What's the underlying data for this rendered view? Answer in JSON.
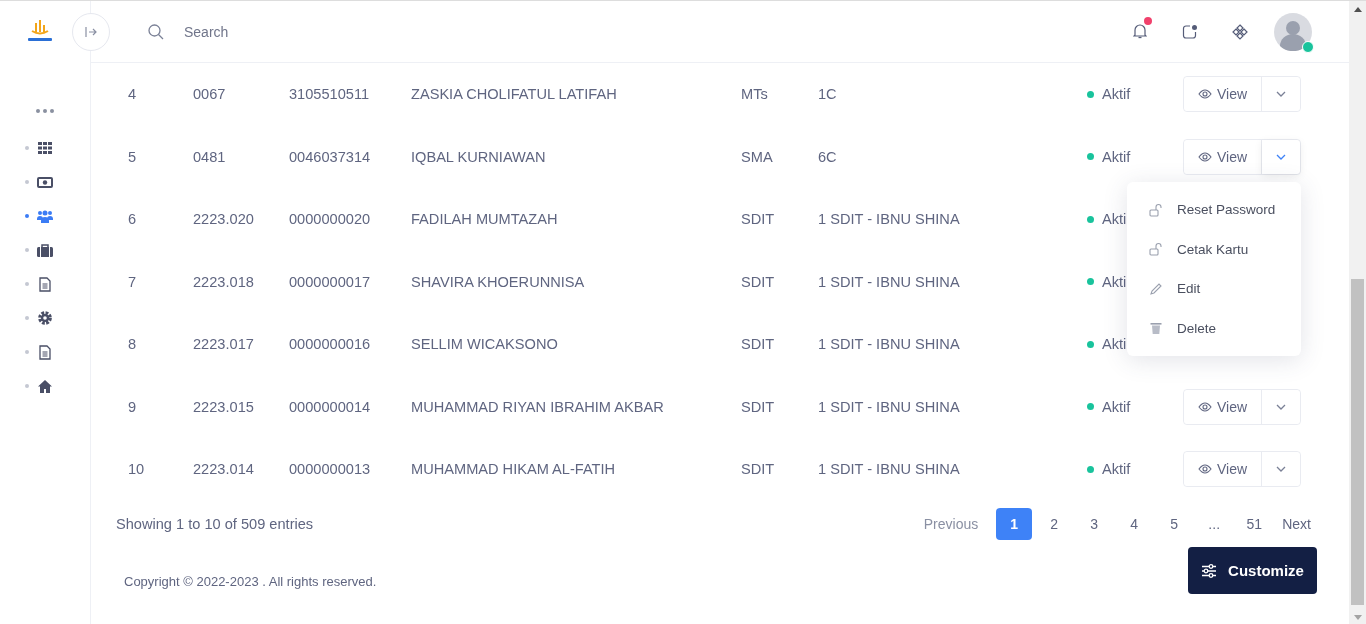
{
  "sidebar": {
    "items": [
      {
        "kind": "more",
        "selected": false
      },
      {
        "kind": "grid",
        "selected": false
      },
      {
        "kind": "money",
        "selected": false
      },
      {
        "kind": "users",
        "selected": true
      },
      {
        "kind": "briefcase",
        "selected": false
      },
      {
        "kind": "document",
        "selected": false
      },
      {
        "kind": "gear",
        "selected": false
      },
      {
        "kind": "document",
        "selected": false
      },
      {
        "kind": "home",
        "selected": false
      }
    ]
  },
  "header": {
    "search": {
      "placeholder": "Search"
    },
    "notifications": {
      "unread": true
    },
    "user": {
      "online": true
    }
  },
  "table": {
    "rows": [
      {
        "no": "4",
        "id": "0067",
        "nisn": "3105510511",
        "name": "ZASKIA CHOLIFATUL LATIFAH",
        "level": "MTs",
        "class": "1C",
        "status": "Aktif",
        "view": "View",
        "expanded": false
      },
      {
        "no": "5",
        "id": "0481",
        "nisn": "0046037314",
        "name": "IQBAL KURNIAWAN",
        "level": "SMA",
        "class": "6C",
        "status": "Aktif",
        "view": "View",
        "expanded": true
      },
      {
        "no": "6",
        "id": "2223.020",
        "nisn": "0000000020",
        "name": "FADILAH MUMTAZAH",
        "level": "SDIT",
        "class": "1 SDIT - IBNU SHINA",
        "status": "Akti"
      },
      {
        "no": "7",
        "id": "2223.018",
        "nisn": "0000000017",
        "name": "SHAVIRA KHOERUNNISA",
        "level": "SDIT",
        "class": "1 SDIT - IBNU SHINA",
        "status": "Akti"
      },
      {
        "no": "8",
        "id": "2223.017",
        "nisn": "0000000016",
        "name": "SELLIM WICAKSONO",
        "level": "SDIT",
        "class": "1 SDIT - IBNU SHINA",
        "status": "Akti"
      },
      {
        "no": "9",
        "id": "2223.015",
        "nisn": "0000000014",
        "name": "MUHAMMAD RIYAN IBRAHIM AKBAR",
        "level": "SDIT",
        "class": "1 SDIT - IBNU SHINA",
        "status": "Aktif",
        "view": "View",
        "expanded": false
      },
      {
        "no": "10",
        "id": "2223.014",
        "nisn": "0000000013",
        "name": "MUHAMMAD HIKAM AL-FATIH",
        "level": "SDIT",
        "class": "1 SDIT - IBNU SHINA",
        "status": "Aktif",
        "view": "View",
        "expanded": false
      }
    ]
  },
  "action_menu": {
    "items": [
      {
        "kind": "lock",
        "label": "Reset Password"
      },
      {
        "kind": "lock",
        "label": "Cetak Kartu"
      },
      {
        "kind": "edit",
        "label": "Edit"
      },
      {
        "kind": "delete",
        "label": "Delete"
      }
    ]
  },
  "pagination": {
    "summary": "Showing 1 to 10 of 509 entries",
    "previous": "Previous",
    "next": "Next",
    "pages": [
      {
        "label": "1",
        "selected": true
      },
      {
        "label": "2",
        "selected": false
      },
      {
        "label": "3",
        "selected": false
      },
      {
        "label": "4",
        "selected": false
      },
      {
        "label": "5",
        "selected": false
      },
      {
        "label": "...",
        "selected": false
      },
      {
        "label": "51",
        "selected": false
      }
    ]
  },
  "footer": {
    "copyright": "Copyright © 2022-2023 . All rights reserved."
  },
  "customize_button": {
    "label": "Customize"
  }
}
